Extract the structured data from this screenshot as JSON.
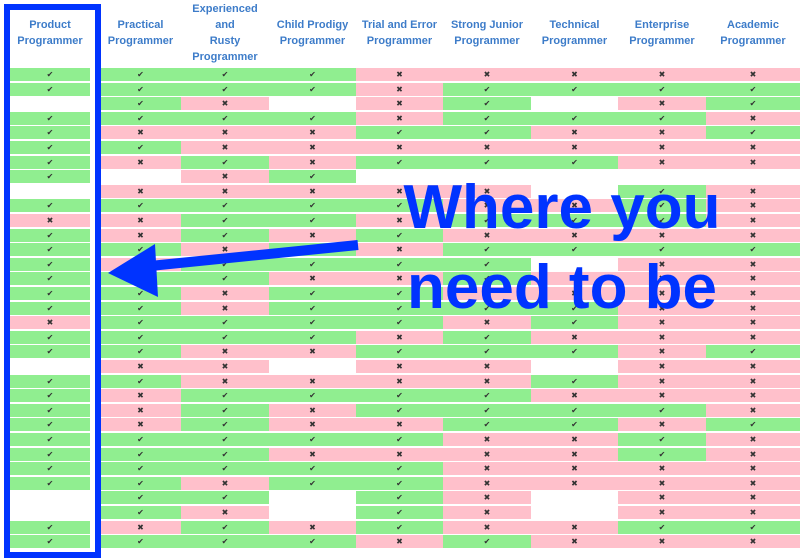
{
  "columns": [
    {
      "label": "Product Programmer",
      "lines": [
        "Product",
        "Programmer"
      ]
    },
    {
      "label": "Practical Programmer",
      "lines": [
        "Practical",
        "Programmer"
      ]
    },
    {
      "label": "Experienced and Rusty Programmer",
      "lines": [
        "Experienced and",
        "Rusty",
        "Programmer"
      ]
    },
    {
      "label": "Child Prodigy Programmer",
      "lines": [
        "Child Prodigy",
        "Programmer"
      ]
    },
    {
      "label": "Trial and Error Programmer",
      "lines": [
        "Trial and Error",
        "Programmer"
      ]
    },
    {
      "label": "Strong Junior Programmer",
      "lines": [
        "Strong Junior",
        "Programmer"
      ]
    },
    {
      "label": "Technical Programmer",
      "lines": [
        "Technical",
        "Programmer"
      ]
    },
    {
      "label": "Enterprise Programmer",
      "lines": [
        "Enterprise",
        "Programmer"
      ]
    },
    {
      "label": "Academic Programmer",
      "lines": [
        "Academic",
        "Programmer"
      ]
    }
  ],
  "symbols": {
    "c": "✔",
    "x": "✖",
    "b": ""
  },
  "colors": {
    "yes": "#90ee90",
    "no": "#ffc0cb",
    "blank": "#ffffff",
    "header_text": "#3d7cc9",
    "highlight": "#0033ff"
  },
  "rows": [
    [
      "c",
      "c",
      "c",
      "c",
      "x",
      "x",
      "x",
      "x",
      "x"
    ],
    [
      "c",
      "c",
      "c",
      "c",
      "x",
      "c",
      "c",
      "c",
      "c"
    ],
    [
      "b",
      "c",
      "x",
      "b",
      "x",
      "c",
      "b",
      "x",
      "c"
    ],
    [
      "c",
      "c",
      "c",
      "c",
      "x",
      "c",
      "c",
      "c",
      "x"
    ],
    [
      "c",
      "x",
      "x",
      "x",
      "c",
      "c",
      "x",
      "x",
      "c"
    ],
    [
      "c",
      "c",
      "x",
      "x",
      "x",
      "x",
      "x",
      "x",
      "x"
    ],
    [
      "c",
      "x",
      "c",
      "x",
      "c",
      "c",
      "c",
      "x",
      "x"
    ],
    [
      "c",
      "b",
      "x",
      "c",
      "b",
      "b",
      "b",
      "b",
      "b"
    ],
    [
      "b",
      "x",
      "x",
      "x",
      "x",
      "x",
      "b",
      "c",
      "x"
    ],
    [
      "c",
      "c",
      "c",
      "c",
      "c",
      "x",
      "x",
      "c",
      "x"
    ],
    [
      "x",
      "x",
      "c",
      "c",
      "x",
      "c",
      "c",
      "c",
      "x"
    ],
    [
      "c",
      "x",
      "c",
      "x",
      "c",
      "x",
      "x",
      "x",
      "x"
    ],
    [
      "c",
      "c",
      "x",
      "c",
      "x",
      "c",
      "c",
      "c",
      "c"
    ],
    [
      "c",
      "x",
      "c",
      "c",
      "c",
      "c",
      "b",
      "x",
      "x"
    ],
    [
      "c",
      "c",
      "c",
      "x",
      "x",
      "c",
      "x",
      "x",
      "x"
    ],
    [
      "c",
      "c",
      "x",
      "c",
      "c",
      "x",
      "x",
      "x",
      "x"
    ],
    [
      "c",
      "c",
      "x",
      "c",
      "c",
      "c",
      "c",
      "x",
      "x"
    ],
    [
      "x",
      "c",
      "c",
      "c",
      "c",
      "x",
      "c",
      "x",
      "x"
    ],
    [
      "c",
      "c",
      "c",
      "c",
      "x",
      "c",
      "x",
      "x",
      "x"
    ],
    [
      "c",
      "c",
      "x",
      "x",
      "c",
      "c",
      "c",
      "x",
      "c"
    ],
    [
      "b",
      "x",
      "x",
      "b",
      "x",
      "x",
      "b",
      "x",
      "x"
    ],
    [
      "c",
      "c",
      "x",
      "x",
      "x",
      "x",
      "c",
      "x",
      "x"
    ],
    [
      "c",
      "x",
      "c",
      "c",
      "c",
      "c",
      "x",
      "x",
      "x"
    ],
    [
      "c",
      "x",
      "c",
      "x",
      "c",
      "c",
      "c",
      "c",
      "x"
    ],
    [
      "c",
      "x",
      "c",
      "x",
      "x",
      "c",
      "c",
      "x",
      "c"
    ],
    [
      "c",
      "c",
      "c",
      "c",
      "c",
      "x",
      "x",
      "c",
      "x"
    ],
    [
      "c",
      "c",
      "c",
      "x",
      "x",
      "x",
      "x",
      "c",
      "x"
    ],
    [
      "c",
      "c",
      "c",
      "c",
      "c",
      "x",
      "x",
      "x",
      "x"
    ],
    [
      "c",
      "c",
      "x",
      "c",
      "c",
      "x",
      "x",
      "x",
      "x"
    ],
    [
      "b",
      "c",
      "c",
      "b",
      "c",
      "x",
      "b",
      "x",
      "x"
    ],
    [
      "b",
      "c",
      "x",
      "b",
      "c",
      "x",
      "b",
      "x",
      "x"
    ],
    [
      "c",
      "x",
      "c",
      "x",
      "c",
      "x",
      "x",
      "c",
      "c"
    ],
    [
      "c",
      "c",
      "c",
      "c",
      "x",
      "c",
      "x",
      "x",
      "x"
    ]
  ],
  "annotation": {
    "line1": "Where you",
    "line2": "need to be"
  }
}
